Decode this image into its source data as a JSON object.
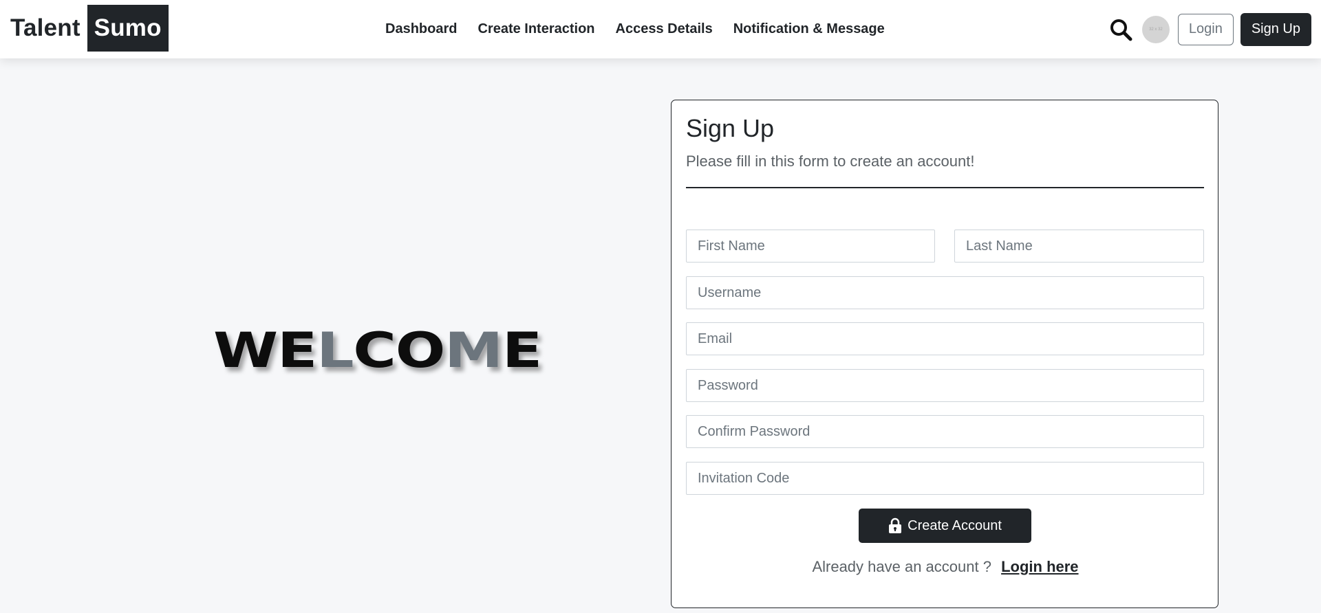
{
  "brand": {
    "part1": "Talent",
    "part2": "Sumo"
  },
  "nav": {
    "links": [
      "Dashboard",
      "Create Interaction",
      "Access Details",
      "Notification & Message"
    ],
    "avatar_text": "32 x 32",
    "login_label": "Login",
    "signup_label": "Sign Up"
  },
  "welcome": {
    "dark1": "WE",
    "gray1": "L",
    "dark2": "CO",
    "gray2": "M",
    "dark3": "E"
  },
  "form": {
    "title": "Sign Up",
    "subtitle": "Please fill in this form to create an account!",
    "fields": {
      "first_name": "First Name",
      "last_name": "Last Name",
      "username": "Username",
      "email": "Email",
      "password": "Password",
      "confirm_password": "Confirm Password",
      "invitation_code": "Invitation Code"
    },
    "submit_label": "Create Account",
    "login_prompt": "Already have an account ?",
    "login_link": "Login here"
  },
  "colors": {
    "primary_dark": "#212529",
    "muted": "#6c757d",
    "page_bg": "#f6f7f9"
  }
}
